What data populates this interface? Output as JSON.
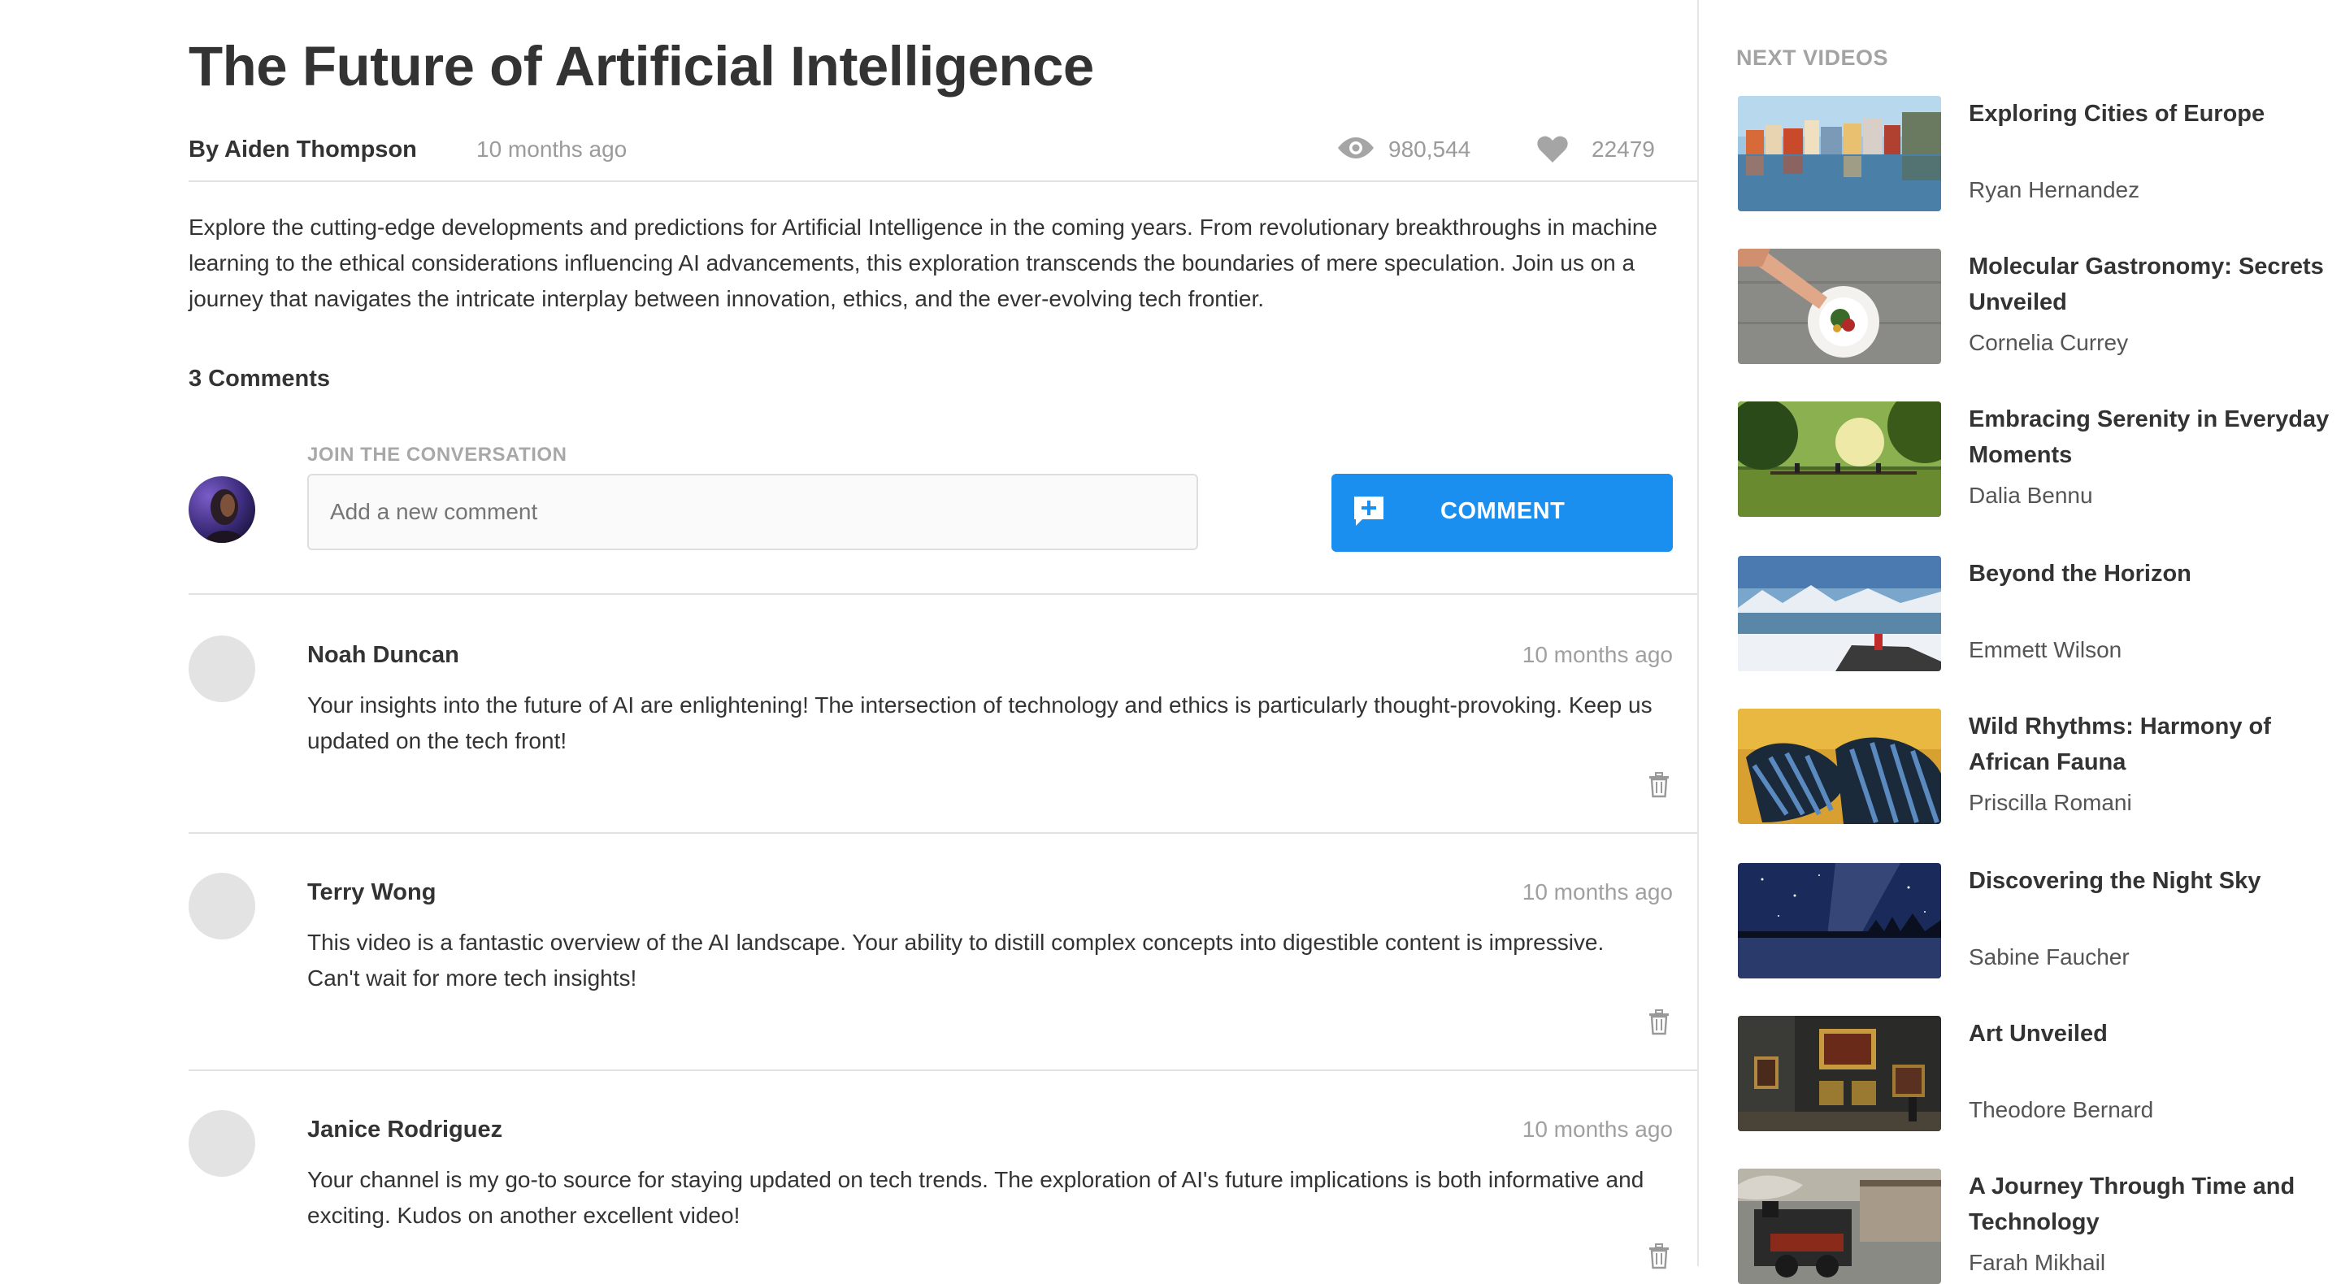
{
  "video": {
    "title": "The Future of Artificial Intelligence",
    "byline": "By Aiden Thompson",
    "posted": "10 months ago",
    "views": "980,544",
    "likes": "22479",
    "description": "Explore the cutting-edge developments and predictions for Artificial Intelligence in the coming years. From revolutionary breakthroughs in machine learning to the ethical considerations influencing AI advancements, this exploration transcends the boundaries of mere speculation. Join us on a journey that navigates the intricate interplay between innovation, ethics, and the ever-evolving tech frontier."
  },
  "comments_section": {
    "count_label": "3 Comments",
    "join_label": "JOIN THE CONVERSATION",
    "input_placeholder": "Add a new comment",
    "button_label": "COMMENT"
  },
  "comments": [
    {
      "author": "Noah Duncan",
      "time": "10 months ago",
      "text": "Your insights into the future of AI are enlightening! The intersection of technology and ethics is particularly thought-provoking. Keep us updated on the tech front!"
    },
    {
      "author": "Terry Wong",
      "time": "10 months ago",
      "text": "This video is a fantastic overview of the AI landscape. Your ability to distill complex concepts into digestible content is impressive. Can't wait for more tech insights!"
    },
    {
      "author": "Janice Rodriguez",
      "time": "10 months ago",
      "text": "Your channel is my go-to source for staying updated on tech trends. The exploration of AI's future implications is both informative and exciting. Kudos on another excellent video!"
    }
  ],
  "sidebar": {
    "heading": "NEXT VIDEOS",
    "videos": [
      {
        "title": "Exploring Cities of Europe",
        "author": "Ryan Hernandez"
      },
      {
        "title": "Molecular Gastronomy: Secrets Unveiled",
        "author": "Cornelia Currey"
      },
      {
        "title": "Embracing Serenity in Everyday Moments",
        "author": "Dalia Bennu"
      },
      {
        "title": "Beyond the Horizon",
        "author": "Emmett Wilson"
      },
      {
        "title": "Wild Rhythms: Harmony of African Fauna",
        "author": "Priscilla Romani"
      },
      {
        "title": "Discovering the Night Sky",
        "author": "Sabine Faucher"
      },
      {
        "title": "Art Unveiled",
        "author": "Theodore Bernard"
      },
      {
        "title": "A Journey Through Time and Technology",
        "author": "Farah Mikhail"
      }
    ]
  },
  "icons": {
    "views": "eye-icon",
    "likes": "heart-icon",
    "comment_button": "add-comment-icon",
    "delete": "trash-icon"
  },
  "colors": {
    "accent": "#1a8fef",
    "muted_text": "#9b9b9b",
    "divider": "#e2e2e2"
  }
}
